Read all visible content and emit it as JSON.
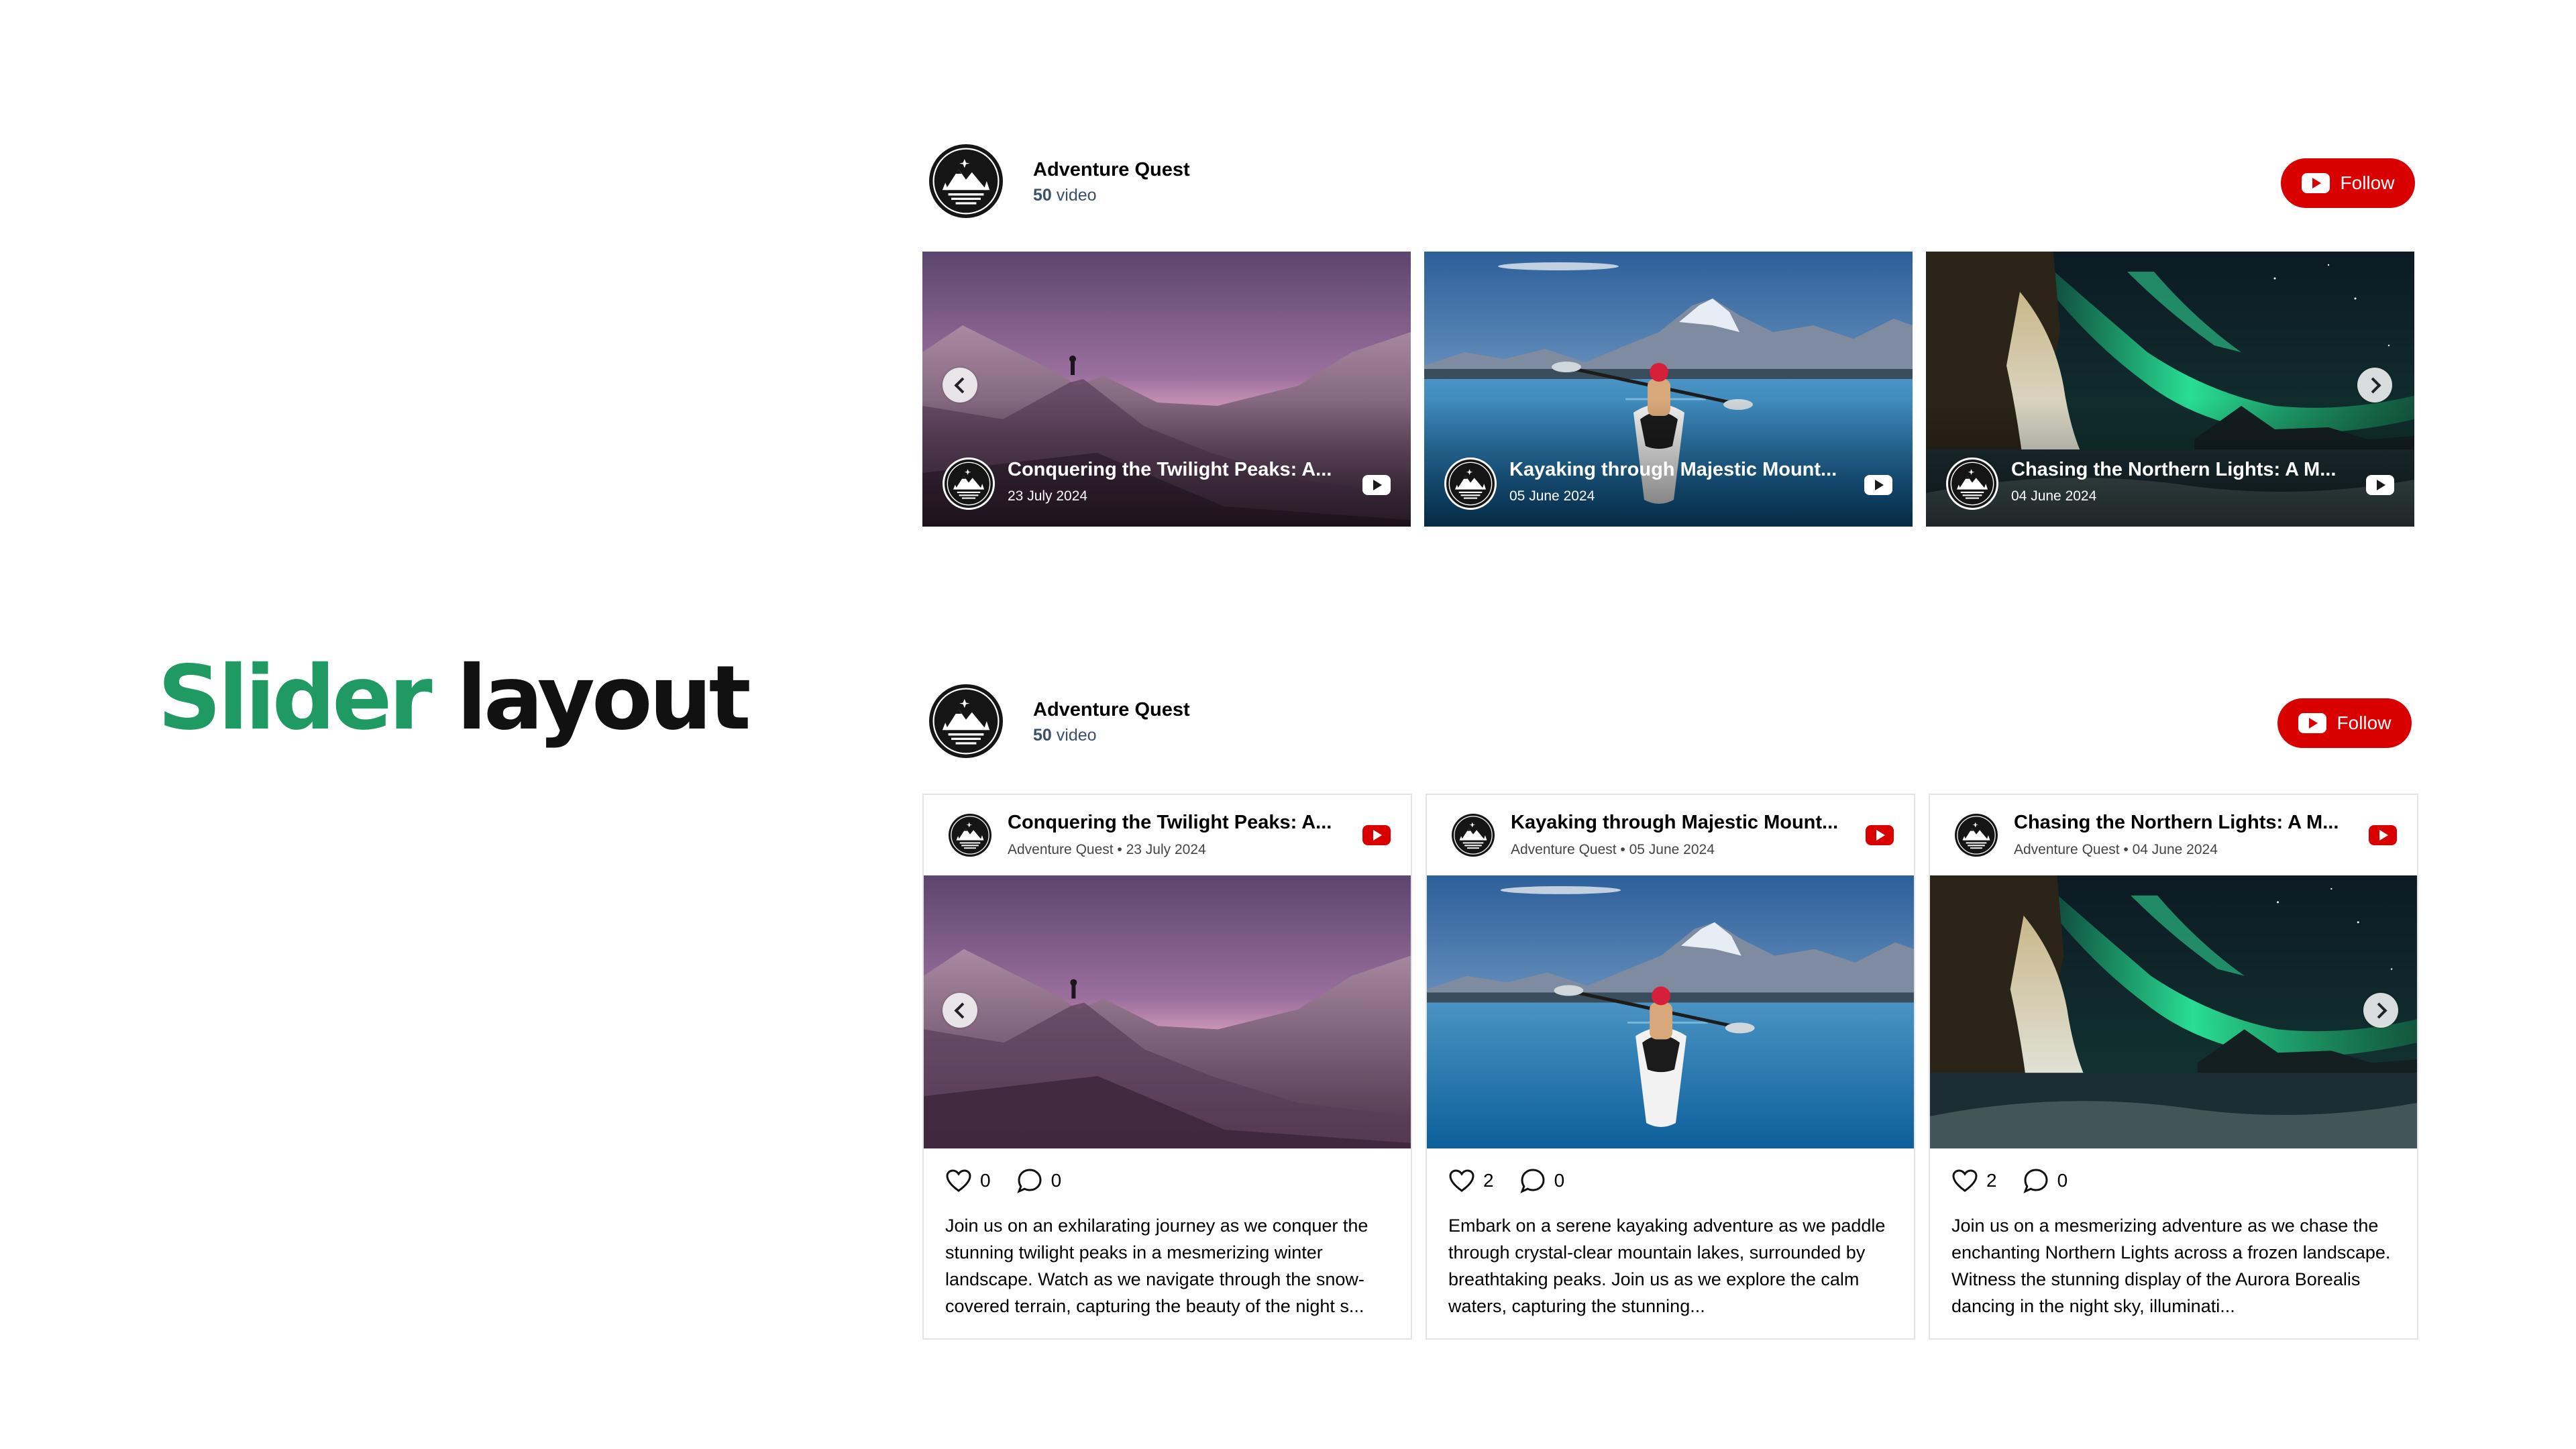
{
  "headline": {
    "word1": "Slider",
    "word2": "layout"
  },
  "colors": {
    "accent_green": "#1f9a63",
    "youtube_red": "#d90000"
  },
  "icons": {
    "channel": "mountain-logo-icon",
    "follow": "youtube-icon",
    "likes": "heart-icon",
    "comments": "comment-bubble-icon",
    "prev": "chevron-left-icon",
    "next": "chevron-right-icon"
  },
  "widgets": [
    {
      "layout": "overlay-slider",
      "channel": {
        "name": "Adventure Quest",
        "count": "50",
        "count_unit": "video"
      },
      "follow_label": "Follow",
      "videos": [
        {
          "title": "Conquering the Twilight Peaks: A...",
          "date": "23 July 2024"
        },
        {
          "title": "Kayaking through Majestic Mount...",
          "date": "05 June 2024"
        },
        {
          "title": "Chasing the Northern Lights: A M...",
          "date": "04 June 2024"
        }
      ]
    },
    {
      "layout": "card-slider",
      "channel": {
        "name": "Adventure Quest",
        "count": "50",
        "count_unit": "video"
      },
      "follow_label": "Follow",
      "videos": [
        {
          "title": "Conquering the Twilight Peaks: A...",
          "meta": "Adventure Quest • 23 July 2024",
          "likes": "0",
          "comments": "0",
          "description": "Join us on an exhilarating journey as we conquer the stunning twilight peaks in a mesmerizing winter landscape. Watch as we navigate through the snow-covered terrain, capturing the beauty of the night s..."
        },
        {
          "title": "Kayaking through Majestic Mount...",
          "meta": "Adventure Quest • 05 June 2024",
          "likes": "2",
          "comments": "0",
          "description": "Embark on a serene kayaking adventure as we paddle through crystal-clear mountain lakes, surrounded by breathtaking peaks. Join us as we explore the calm waters, capturing the stunning..."
        },
        {
          "title": "Chasing the Northern Lights: A M...",
          "meta": "Adventure Quest • 04 June 2024",
          "likes": "2",
          "comments": "0",
          "description": "Join us on a mesmerizing adventure as we chase the enchanting Northern Lights across a frozen landscape. Witness the stunning display of the Aurora Borealis dancing in the night sky, illuminati..."
        }
      ]
    }
  ]
}
